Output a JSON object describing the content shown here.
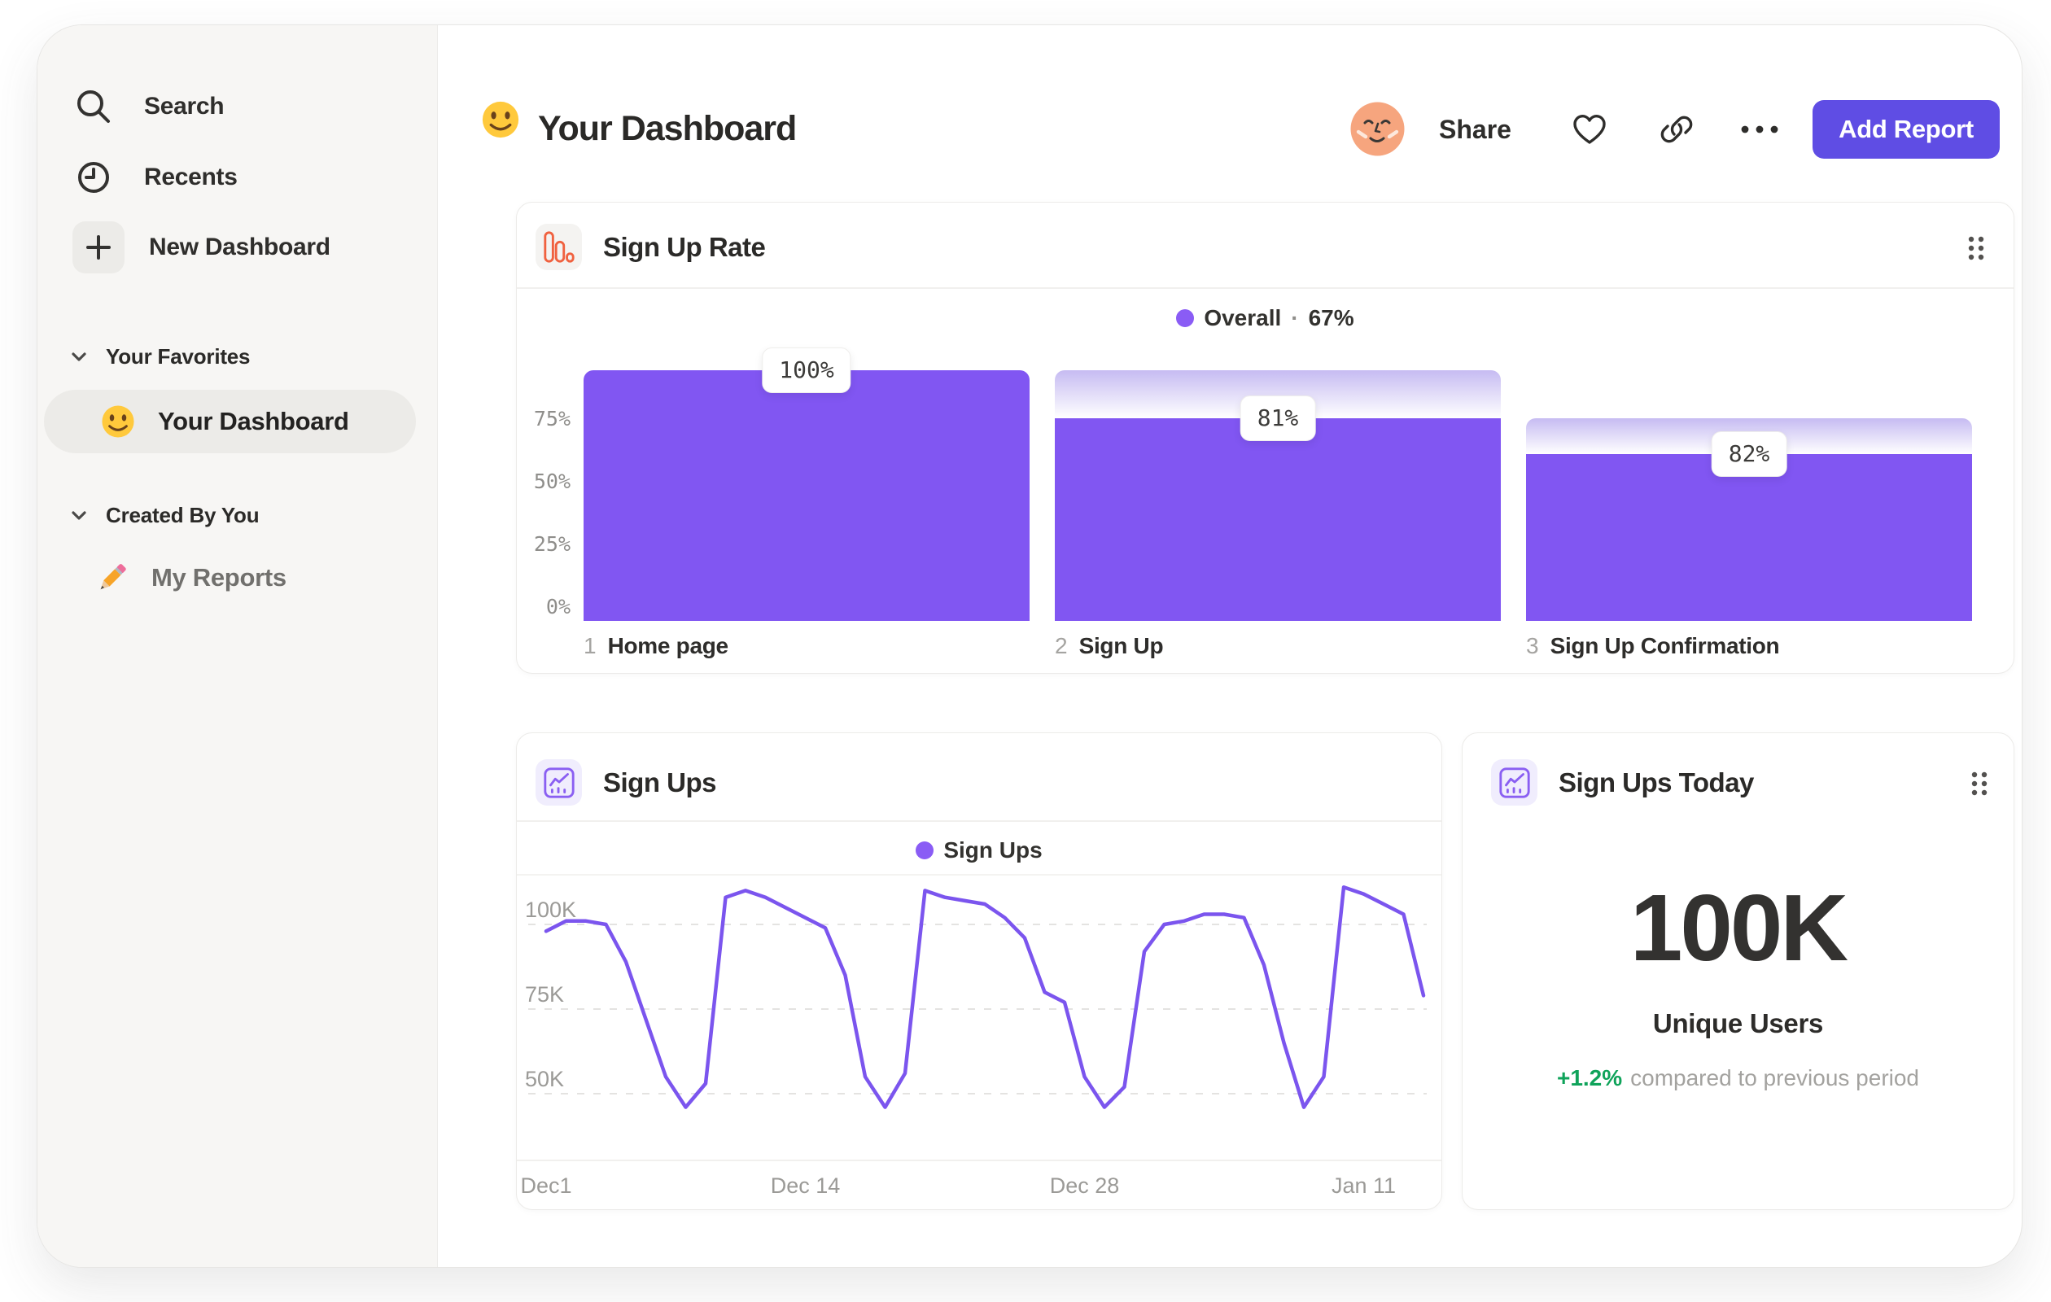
{
  "header": {
    "title": "Your Dashboard",
    "title_emoji": "smiley-face",
    "share_label": "Share",
    "add_report_label": "Add Report"
  },
  "sidebar": {
    "nav": [
      {
        "label": "Search",
        "icon": "search-icon"
      },
      {
        "label": "Recents",
        "icon": "clock-icon"
      },
      {
        "label": "New Dashboard",
        "icon": "plus-icon"
      }
    ],
    "sections": [
      {
        "label": "Your Favorites",
        "items": [
          {
            "label": "Your Dashboard",
            "icon": "smiley-emoji",
            "selected": true
          }
        ]
      },
      {
        "label": "Created By You",
        "items": [
          {
            "label": "My Reports",
            "icon": "pencil-emoji",
            "selected": false
          }
        ]
      }
    ]
  },
  "cards": {
    "funnel": {
      "title": "Sign Up Rate",
      "icon": "bar-chart-icon",
      "legend_label": "Overall",
      "legend_sep": "·",
      "legend_value": "67%"
    },
    "line": {
      "title": "Sign Ups",
      "icon": "line-chart-icon",
      "legend_label": "Sign Ups"
    },
    "metric": {
      "title": "Sign Ups Today",
      "icon": "line-chart-icon",
      "value": "100K",
      "value_label": "Unique Users",
      "delta": "+1.2%",
      "delta_label": "compared to previous period"
    }
  },
  "chart_data": [
    {
      "type": "bar",
      "title": "Sign Up Rate",
      "legend": "Overall · 67%",
      "categories": [
        "Home page",
        "Sign Up",
        "Sign Up Confirmation"
      ],
      "step_numbers": [
        "1",
        "2",
        "3"
      ],
      "step_conversion_pct": [
        100,
        81,
        82
      ],
      "cumulative_pct": [
        100,
        81,
        66.4
      ],
      "value_labels": [
        "100%",
        "81%",
        "82%"
      ],
      "y_tick_labels": [
        "75%",
        "50%",
        "25%",
        "0%"
      ],
      "y_tick_values": [
        75,
        50,
        25,
        0
      ],
      "ylim": [
        0,
        100
      ],
      "bar_color": "#8156F2",
      "dropoff_gradient_top": "#C6BBF2"
    },
    {
      "type": "line",
      "title": "Sign Ups",
      "legend": "Sign Ups",
      "x_tick_labels": [
        "Dec1",
        "Dec 14",
        "Dec 28",
        "Jan 11"
      ],
      "x_tick_day_index": [
        0,
        13,
        27,
        41
      ],
      "y_tick_labels": [
        "100K",
        "75K",
        "50K"
      ],
      "y_tick_values": [
        100,
        75,
        50
      ],
      "unit": "K sign ups per day",
      "values_k": [
        98,
        101,
        101,
        100,
        89,
        72,
        55,
        46,
        53,
        108,
        110,
        108,
        105,
        102,
        99,
        85,
        55,
        46,
        56,
        110,
        108,
        107,
        106,
        102,
        96,
        80,
        77,
        55,
        46,
        52,
        92,
        100,
        101,
        103,
        103,
        102,
        88,
        65,
        46,
        55,
        111,
        109,
        106,
        103,
        79
      ],
      "ylim": [
        40,
        115
      ],
      "line_color": "#7B55EE",
      "grid": "dashed-horizontal"
    }
  ],
  "colors": {
    "accent_purple": "#8156F2",
    "line_purple": "#7B55EE",
    "legend_dot": "#8A5CF5",
    "button_purple": "#5F4DE4",
    "positive_green": "#0FA35A",
    "funnel_icon_orange": "#F0613F",
    "avatar_skin": "#F6A57E",
    "sidebar_bg": "#F7F6F4",
    "selected_pill": "#ECEBE8"
  }
}
